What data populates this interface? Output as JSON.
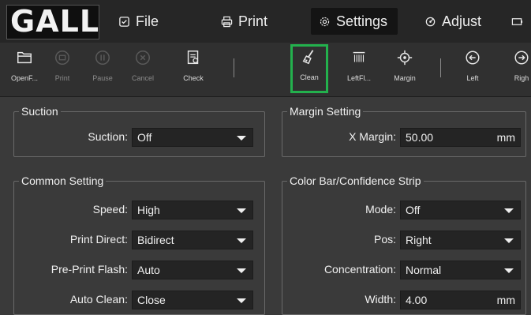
{
  "logo": {
    "text": "GALL"
  },
  "menu": [
    {
      "label": "File",
      "icon": "file-icon"
    },
    {
      "label": "Print",
      "icon": "printer-icon"
    },
    {
      "label": "Settings",
      "icon": "gear-icon",
      "active": true
    },
    {
      "label": "Adjust",
      "icon": "adjust-icon"
    }
  ],
  "toolbar": {
    "open": "OpenF...",
    "print": "Print",
    "pause": "Pause",
    "cancel": "Cancel",
    "check": "Check",
    "clean": "Clean",
    "leftfl": "LeftFl...",
    "margin": "Margin",
    "left": "Left",
    "right": "Righ"
  },
  "suction": {
    "title": "Suction",
    "label": "Suction:",
    "value": "Off"
  },
  "margin_setting": {
    "title": "Margin Setting",
    "label": "X Margin:",
    "value": "50.00",
    "unit": "mm"
  },
  "common": {
    "title": "Common Setting",
    "speed_label": "Speed:",
    "speed_value": "High",
    "direct_label": "Print Direct:",
    "direct_value": "Bidirect",
    "flash_label": "Pre-Print Flash:",
    "flash_value": "Auto",
    "clean_label": "Auto Clean:",
    "clean_value": "Close"
  },
  "colorbar": {
    "title": "Color Bar/Confidence Strip",
    "mode_label": "Mode:",
    "mode_value": "Off",
    "pos_label": "Pos:",
    "pos_value": "Right",
    "conc_label": "Concentration:",
    "conc_value": "Normal",
    "width_label": "Width:",
    "width_value": "4.00",
    "width_unit": "mm"
  },
  "colors": {
    "selected_outline": "#23b14d",
    "background": "#3a3a3a",
    "topbar": "#262626"
  }
}
